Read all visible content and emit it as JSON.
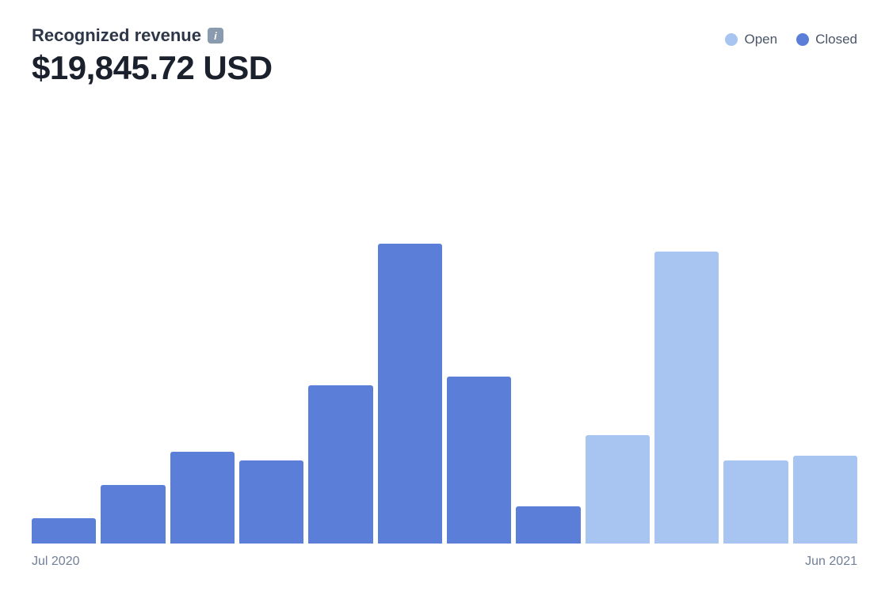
{
  "header": {
    "title": "Recognized revenue",
    "info_icon": "i",
    "amount": "$19,845.72 USD"
  },
  "legend": {
    "open_label": "Open",
    "closed_label": "Closed",
    "open_color": "#a8c4f0",
    "closed_color": "#5b7ed9"
  },
  "chart": {
    "bars": [
      {
        "type": "closed",
        "height_pct": 6
      },
      {
        "type": "closed",
        "height_pct": 14
      },
      {
        "type": "closed",
        "height_pct": 22
      },
      {
        "type": "closed",
        "height_pct": 20
      },
      {
        "type": "closed",
        "height_pct": 38
      },
      {
        "type": "closed",
        "height_pct": 72
      },
      {
        "type": "closed",
        "height_pct": 40
      },
      {
        "type": "closed",
        "height_pct": 9
      },
      {
        "type": "open",
        "height_pct": 26
      },
      {
        "type": "open",
        "height_pct": 70
      },
      {
        "type": "open",
        "height_pct": 20
      },
      {
        "type": "open",
        "height_pct": 21
      }
    ],
    "x_labels": [
      {
        "text": "Jul 2020"
      },
      {
        "text": "Jun 2021"
      }
    ]
  }
}
